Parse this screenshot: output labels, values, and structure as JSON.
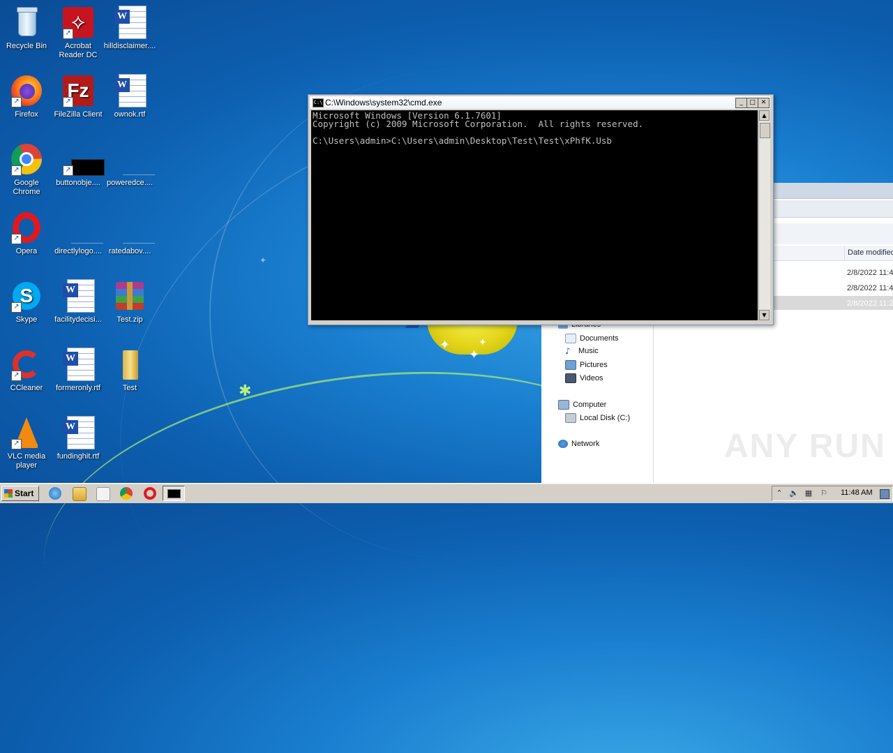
{
  "desktop": {
    "icons": [
      {
        "label": "Recycle Bin"
      },
      {
        "label": "Acrobat Reader DC"
      },
      {
        "label": "hilldisclaimer...."
      },
      {
        "label": "Firefox"
      },
      {
        "label": "FileZilla Client"
      },
      {
        "label": "ownok.rtf"
      },
      {
        "label": "Google Chrome"
      },
      {
        "label": "buttonobje...."
      },
      {
        "label": "poweredce...."
      },
      {
        "label": "Opera"
      },
      {
        "label": "directlylogo...."
      },
      {
        "label": "ratedabov...."
      },
      {
        "label": "Skype"
      },
      {
        "label": "facilitydecisi..."
      },
      {
        "label": "Test.zip"
      },
      {
        "label": "CCleaner"
      },
      {
        "label": "formeronly.rtf"
      },
      {
        "label": "Test"
      },
      {
        "label": "VLC media player"
      },
      {
        "label": "fundinghit.rtf"
      }
    ]
  },
  "cmd": {
    "title": "C:\\Windows\\system32\\cmd.exe",
    "output": "Microsoft Windows [Version 6.1.7601]\nCopyright (c) 2009 Microsoft Corporation.  All rights reserved.\n\nC:\\Users\\admin>C:\\Users\\admin\\Desktop\\Test\\Test\\xPhfK.Usb"
  },
  "explorer": {
    "column_date": "Date modified",
    "rows": [
      {
        "date": "2/8/2022 11:4"
      },
      {
        "date": "2/8/2022 11:4"
      },
      {
        "date": "2/8/2022 11:2"
      }
    ],
    "nav": {
      "libraries": "Libraries",
      "documents": "Documents",
      "music": "Music",
      "pictures": "Pictures",
      "videos": "Videos",
      "computer": "Computer",
      "local_disk": "Local Disk (C:)",
      "network": "Network"
    }
  },
  "watermark": "ANY RUN",
  "taskbar": {
    "start_label": "Start",
    "clock": "11:48 AM"
  }
}
